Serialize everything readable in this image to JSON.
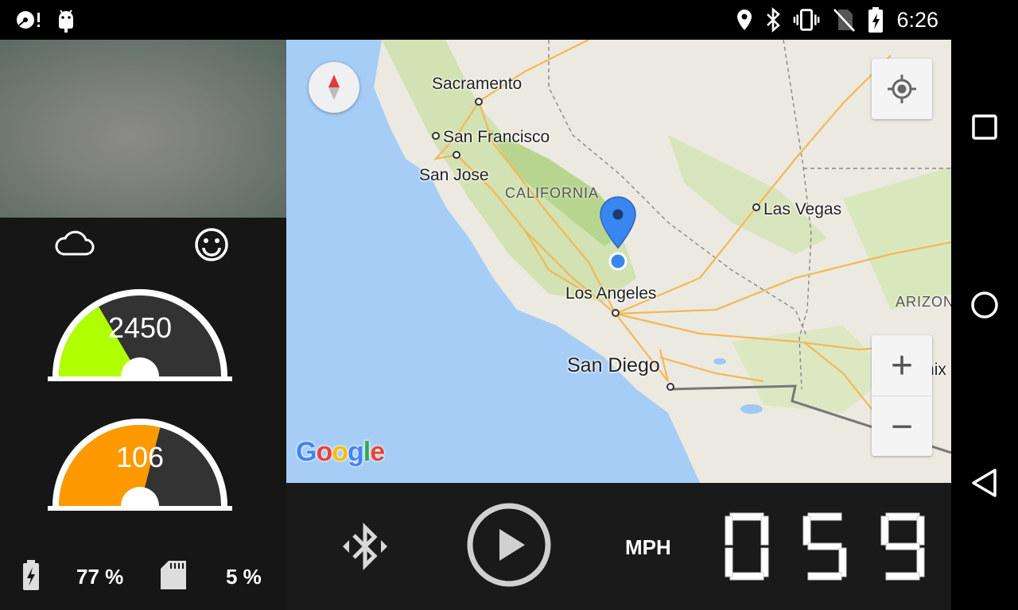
{
  "status_bar": {
    "time": "6:26",
    "left_icons": [
      "disk-warning-icon",
      "android-debug-icon"
    ],
    "right_icons": [
      "location-pin-icon",
      "bluetooth-icon",
      "vibrate-icon",
      "no-sim-icon",
      "battery-charging-icon"
    ]
  },
  "gauges": {
    "rpm": {
      "value": "2450",
      "fill_fraction": 0.33,
      "color": "#b0ff00"
    },
    "temp": {
      "value": "106",
      "fill_fraction": 0.58,
      "color": "#ff9900"
    }
  },
  "left_panel": {
    "weather_icon": "cloud-icon",
    "mood_icon": "smiley-icon",
    "battery_percent": "77 %",
    "storage_percent": "5 %"
  },
  "map": {
    "cities": {
      "sacramento": "Sacramento",
      "san_francisco": "San Francisco",
      "san_jose": "San Jose",
      "las_vegas": "Las Vegas",
      "los_angeles": "Los Angeles",
      "san_diego": "San Diego",
      "phoenix": "Phoenix"
    },
    "regions": {
      "california": "CALIFORNIA",
      "arizona": "ARIZONA"
    },
    "logo": "Google",
    "zoom_in": "+",
    "zoom_out": "−"
  },
  "controls": {
    "speed_unit": "MPH",
    "speed_digits": [
      "0",
      "5",
      "9"
    ]
  },
  "colors": {
    "water": "#a6cdf6",
    "land": "#ece9e1",
    "park": "#cde0a8",
    "road": "#f6c36a",
    "marker": "#3a86f0",
    "rpm_fill": "#b0ff00",
    "temp_fill": "#ff9900"
  }
}
